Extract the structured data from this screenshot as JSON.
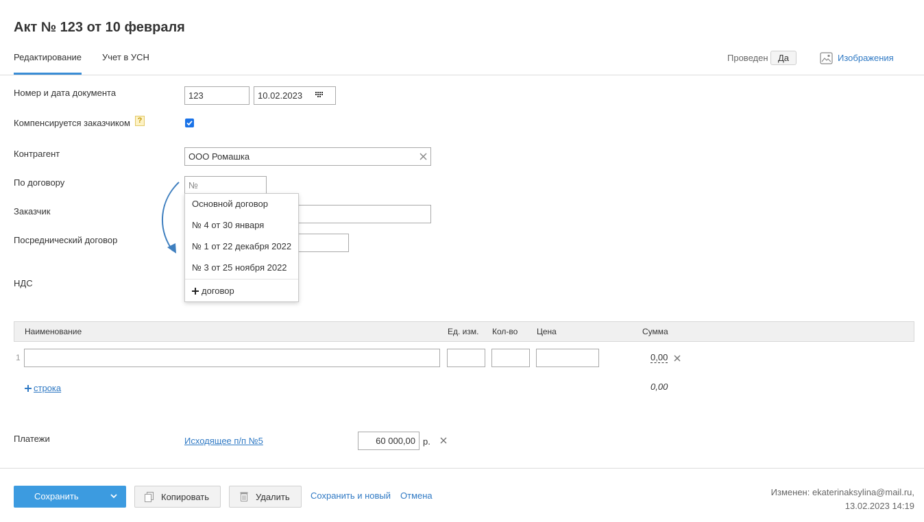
{
  "page": {
    "title": "Акт № 123 от 10 февраля"
  },
  "tabs": [
    {
      "label": "Редактирование"
    },
    {
      "label": "Учет в УСН"
    }
  ],
  "header": {
    "posted_label": "Проведен",
    "posted_value": "Да",
    "images_label": "Изображения"
  },
  "form": {
    "doc_label": "Номер и дата документа",
    "doc_number": "123",
    "doc_date": "10.02.2023",
    "compensated_label": "Компенсируется заказчиком",
    "help_mark": "?",
    "compensated_checked": true,
    "contractor_label": "Контрагент",
    "contractor_value": "ООО Ромашка",
    "contract_label": "По договору",
    "contract_placeholder": "№",
    "customer_label": "Заказчик",
    "agent_contract_label": "Посреднический договор",
    "vat_label": "НДС"
  },
  "contract_dropdown": {
    "items": [
      "Основной договор",
      "№ 4 от 30 января",
      "№ 1 от 22 декабря 2022",
      "№ 3 от 25 ноября 2022"
    ],
    "add_label": "договор"
  },
  "table": {
    "headers": {
      "name": "Наименование",
      "unit": "Ед. изм.",
      "qty": "Кол-во",
      "price": "Цена",
      "sum": "Сумма"
    },
    "rows": [
      {
        "num": "1",
        "sum": "0,00"
      }
    ],
    "add_row_label": "строка",
    "total": "0,00"
  },
  "payments": {
    "label": "Платежи",
    "doc_link": "Исходящее п/п №5",
    "amount": "60 000,00",
    "currency": "р."
  },
  "footer": {
    "save_label": "Сохранить",
    "copy_label": "Копировать",
    "delete_label": "Удалить",
    "save_new_label": "Сохранить и новый",
    "cancel_label": "Отмена",
    "changed_by": "Изменен: ekaterinaksylina@mail.ru,",
    "changed_at": "13.02.2023 14:19"
  },
  "colors": {
    "accent": "#3c9be0",
    "link": "#2f79c4",
    "tab_underline": "#3a8dd6",
    "arrow": "#3f7fbf"
  },
  "icons": [
    "calendar-icon",
    "help-icon",
    "clear-icon",
    "image-icon",
    "plus-icon",
    "chevron-down-icon",
    "copy-icon",
    "trash-icon",
    "delete-row-icon",
    "arrow-annotation"
  ]
}
